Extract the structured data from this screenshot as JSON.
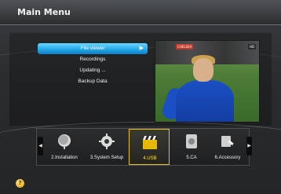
{
  "window": {
    "title": "Main Menu"
  },
  "submenu": {
    "items": [
      {
        "label": "File viewer",
        "active": true
      },
      {
        "label": "Recordings",
        "active": false
      },
      {
        "label": "Updating ...",
        "active": false
      },
      {
        "label": "Backup Data",
        "active": false
      }
    ],
    "active_arrow": "▶"
  },
  "preview": {
    "score_badge": "CHELSEA",
    "channel_badge": "HD"
  },
  "strip": {
    "left_arrow": "◀",
    "right_arrow": "▶",
    "tiles": [
      {
        "label": "2.Installation",
        "icon": "satellite-dish-icon"
      },
      {
        "label": "3.System Setup",
        "icon": "gear-icon"
      },
      {
        "label": "4.USB",
        "icon": "clapperboard-icon",
        "active": true
      },
      {
        "label": "5.CA",
        "icon": "card-icon"
      },
      {
        "label": "6.Accessory",
        "icon": "tools-icon"
      }
    ]
  },
  "help": {
    "symbol": "?"
  },
  "colors": {
    "accent": "#1fa4e6",
    "highlight": "#e8c21a"
  }
}
